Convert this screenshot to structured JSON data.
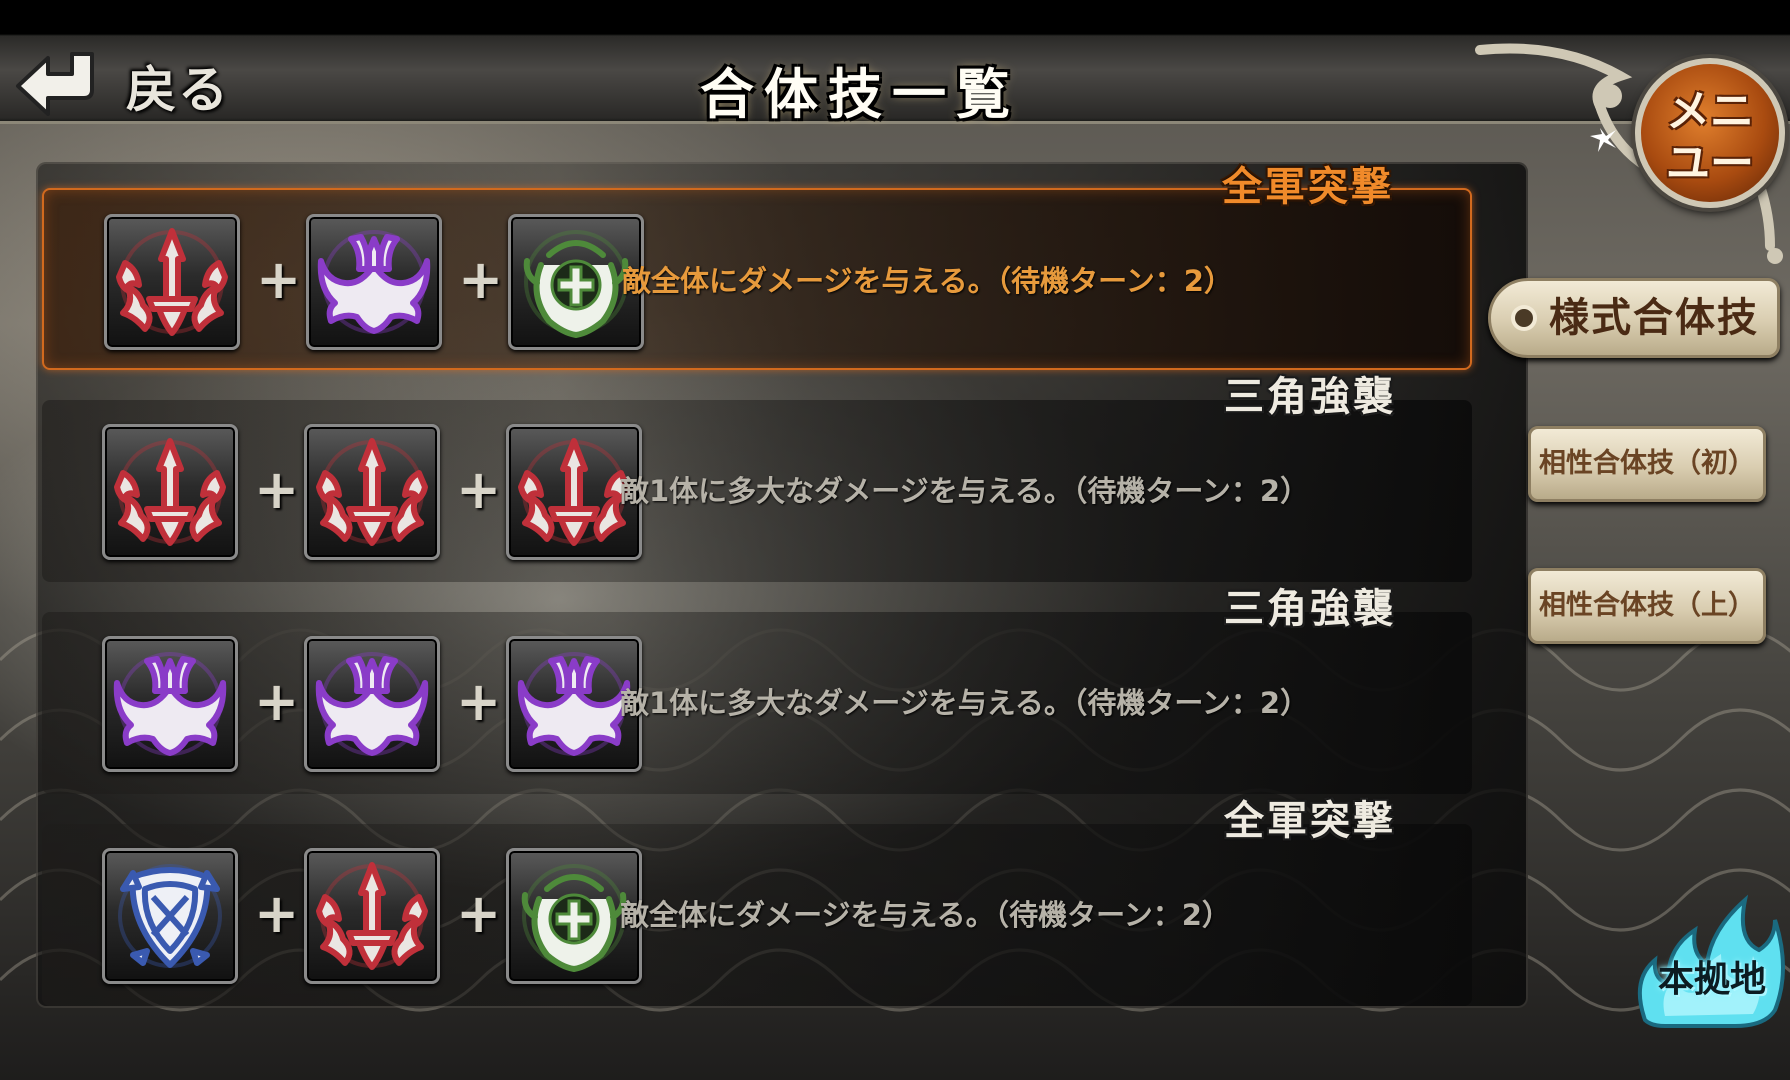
{
  "header": {
    "back_label": "戻る",
    "title": "合体技一覧"
  },
  "menu": {
    "label_line1": "メニ",
    "label_line2": "ユー"
  },
  "combos": [
    {
      "name": "全軍突撃",
      "description": "敵全体にダメージを与える。（待機ターン：2）",
      "selected": true,
      "icons": [
        "red-sword-crest-icon",
        "purple-wing-crest-icon",
        "green-cross-crest-icon"
      ]
    },
    {
      "name": "三角強襲",
      "description": "敵1体に多大なダメージを与える。（待機ターン：2）",
      "selected": false,
      "icons": [
        "red-sword-crest-icon",
        "red-sword-crest-icon",
        "red-sword-crest-icon"
      ]
    },
    {
      "name": "三角強襲",
      "description": "敵1体に多大なダメージを与える。（待機ターン：2）",
      "selected": false,
      "icons": [
        "purple-wing-crest-icon",
        "purple-wing-crest-icon",
        "purple-wing-crest-icon"
      ]
    },
    {
      "name": "全軍突撃",
      "description": "敵全体にダメージを与える。（待機ターン：2）",
      "selected": false,
      "icons": [
        "blue-shield-crest-icon",
        "red-sword-crest-icon",
        "green-cross-crest-icon"
      ]
    }
  ],
  "plus_symbol": "+",
  "side_tabs": {
    "style": "様式合体技",
    "affinity_first": "相性合体技（初）",
    "affinity_upper": "相性合体技（上）"
  },
  "home": {
    "label": "本拠地"
  },
  "colors": {
    "selected_accent": "#f08a2a",
    "red_crest": "#c0303a",
    "purple_crest": "#8a3cc8",
    "green_crest": "#4e8a3a",
    "blue_crest": "#3a5ab0",
    "home_glow": "#5fe0f0"
  }
}
